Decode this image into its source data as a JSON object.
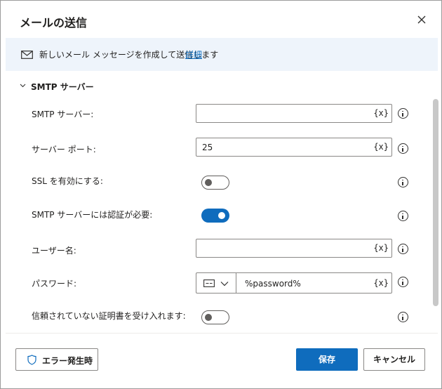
{
  "dialog": {
    "title": "メールの送信"
  },
  "banner": {
    "message": "新しいメール メッセージを作成して送信します",
    "link": "詳細"
  },
  "section": {
    "title": "SMTP サーバー"
  },
  "fields": {
    "smtp_server": {
      "label": "SMTP サーバー:",
      "value": "",
      "var_button": "{x}"
    },
    "server_port": {
      "label": "サーバー ポート:",
      "value": "25",
      "var_button": "{x}"
    },
    "ssl": {
      "label": "SSL を有効にする:",
      "enabled": false
    },
    "auth_required": {
      "label": "SMTP サーバーには認証が必要:",
      "enabled": true
    },
    "username": {
      "label": "ユーザー名:",
      "value": "",
      "var_button": "{x}"
    },
    "password": {
      "label": "パスワード:",
      "value": "%password%",
      "var_button": "{x}"
    },
    "untrusted_certs": {
      "label": "信頼されていない証明書を受け入れます:",
      "enabled": false
    }
  },
  "footer": {
    "on_error_label": "エラー発生時",
    "save_label": "保存",
    "cancel_label": "キャンセル"
  },
  "colors": {
    "accent": "#0f6cbd",
    "banner_bg": "#eef4fb"
  }
}
